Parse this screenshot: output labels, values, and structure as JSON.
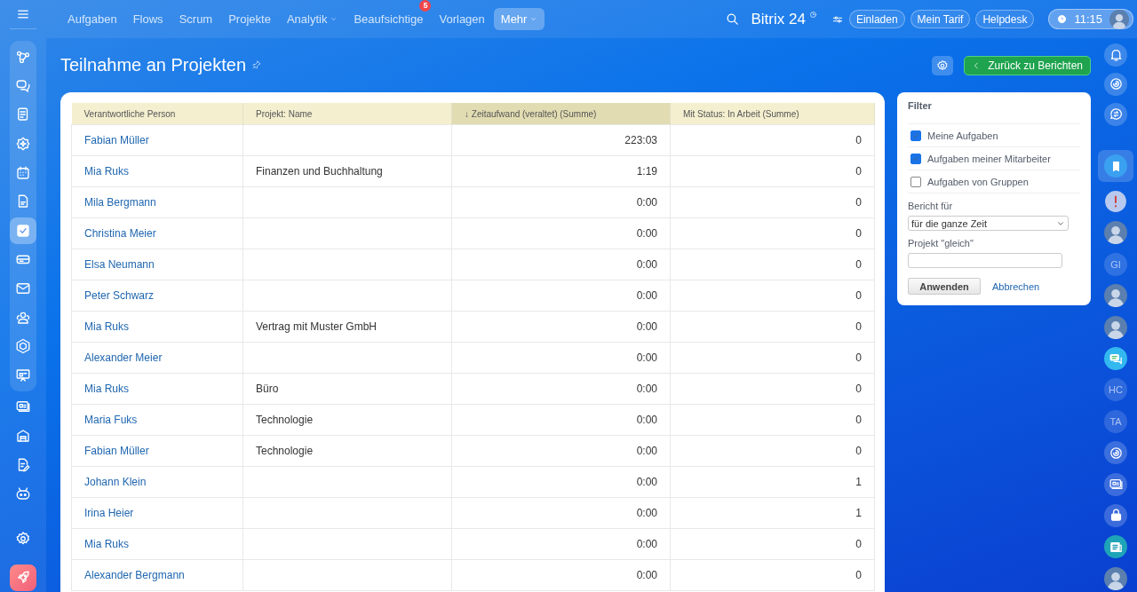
{
  "top_nav": {
    "items": [
      {
        "label": "Aufgaben",
        "selected": false,
        "dropdown": false
      },
      {
        "label": "Flows",
        "selected": false,
        "dropdown": false
      },
      {
        "label": "Scrum",
        "selected": false,
        "dropdown": false
      },
      {
        "label": "Projekte",
        "selected": false,
        "dropdown": false
      },
      {
        "label": "Analytik",
        "selected": false,
        "dropdown": true
      },
      {
        "label": "Beaufsichtige",
        "selected": false,
        "dropdown": false,
        "badge": "5"
      },
      {
        "label": "Vorlagen",
        "selected": false,
        "dropdown": false
      },
      {
        "label": "Mehr",
        "selected": true,
        "dropdown": true
      }
    ],
    "brand": "Bitrix",
    "brand_number": "24",
    "buttons": [
      "Einladen",
      "Mein Tarif",
      "Helpdesk"
    ],
    "clock": "11:15"
  },
  "left_nav": [
    {
      "selected": false
    },
    {
      "selected": false
    },
    {
      "selected": false
    },
    {
      "selected": false
    },
    {
      "selected": false
    },
    {
      "selected": false
    },
    {
      "selected": true
    },
    {
      "selected": false
    },
    {
      "selected": false
    },
    {
      "selected": false
    },
    {
      "selected": false
    },
    {
      "selected": false
    },
    {
      "selected": false
    },
    {
      "selected": false
    },
    {
      "selected": false
    },
    {
      "selected": false
    },
    {
      "selected": false
    },
    {
      "selected": false
    }
  ],
  "page": {
    "title": "Teilnahme an Projekten",
    "back_button": "Zurück zu Berichten"
  },
  "table": {
    "columns": [
      {
        "label": "Verantwortliche Person",
        "kind": "person",
        "sorted": false
      },
      {
        "label": "Projekt: Name",
        "kind": "text",
        "sorted": false
      },
      {
        "label": "↓ Zeitaufwand (veraltet) (Summe)",
        "kind": "number",
        "sorted": true
      },
      {
        "label": "Mit Status: In Arbeit (Summe)",
        "kind": "number",
        "sorted": false
      }
    ],
    "rows": [
      [
        "Fabian Müller",
        "",
        "223:03",
        "0"
      ],
      [
        "Mia Ruks",
        "Finanzen und Buchhaltung",
        "1:19",
        "0"
      ],
      [
        "Mila Bergmann",
        "",
        "0:00",
        "0"
      ],
      [
        "Christina Meier",
        "",
        "0:00",
        "0"
      ],
      [
        "Elsa Neumann",
        "",
        "0:00",
        "0"
      ],
      [
        "Peter Schwarz",
        "",
        "0:00",
        "0"
      ],
      [
        "Mia Ruks",
        "Vertrag mit Muster GmbH",
        "0:00",
        "0"
      ],
      [
        "Alexander Meier",
        "",
        "0:00",
        "0"
      ],
      [
        "Mia Ruks",
        "Büro",
        "0:00",
        "0"
      ],
      [
        "Maria Fuks",
        "Technologie",
        "0:00",
        "0"
      ],
      [
        "Fabian Müller",
        "Technologie",
        "0:00",
        "0"
      ],
      [
        "Johann Klein",
        "",
        "0:00",
        "1"
      ],
      [
        "Irina Heier",
        "",
        "0:00",
        "1"
      ],
      [
        "Mia Ruks",
        "",
        "0:00",
        "0"
      ],
      [
        "Alexander Bergmann",
        "",
        "0:00",
        "0"
      ]
    ]
  },
  "filter": {
    "title": "Filter",
    "options": [
      {
        "label": "Meine Aufgaben",
        "checked": true
      },
      {
        "label": "Aufgaben meiner Mitarbeiter",
        "checked": true
      },
      {
        "label": "Aufgaben von Gruppen",
        "checked": false
      }
    ],
    "report_for_label": "Bericht für",
    "report_for_value": "für die ganze Zeit",
    "project_label": "Projekt \"gleich\"",
    "apply": "Anwenden",
    "cancel": "Abbrechen"
  },
  "right_rail": [
    {
      "kind": "icon",
      "selected": false
    },
    {
      "kind": "icon",
      "selected": false
    },
    {
      "kind": "icon",
      "selected": false
    },
    {
      "kind": "icon",
      "selected": true
    },
    {
      "kind": "icon",
      "selected": false
    },
    {
      "kind": "avatar",
      "selected": false
    },
    {
      "kind": "initials",
      "text": "GI",
      "selected": false
    },
    {
      "kind": "avatar",
      "selected": false
    },
    {
      "kind": "avatar",
      "selected": false
    },
    {
      "kind": "icon",
      "selected": false
    },
    {
      "kind": "initials",
      "text": "HC",
      "selected": false
    },
    {
      "kind": "initials",
      "text": "TA",
      "selected": false
    },
    {
      "kind": "icon",
      "selected": false
    },
    {
      "kind": "icon",
      "selected": false
    },
    {
      "kind": "icon",
      "selected": false
    },
    {
      "kind": "icon",
      "selected": false
    },
    {
      "kind": "avatar",
      "selected": false
    }
  ]
}
